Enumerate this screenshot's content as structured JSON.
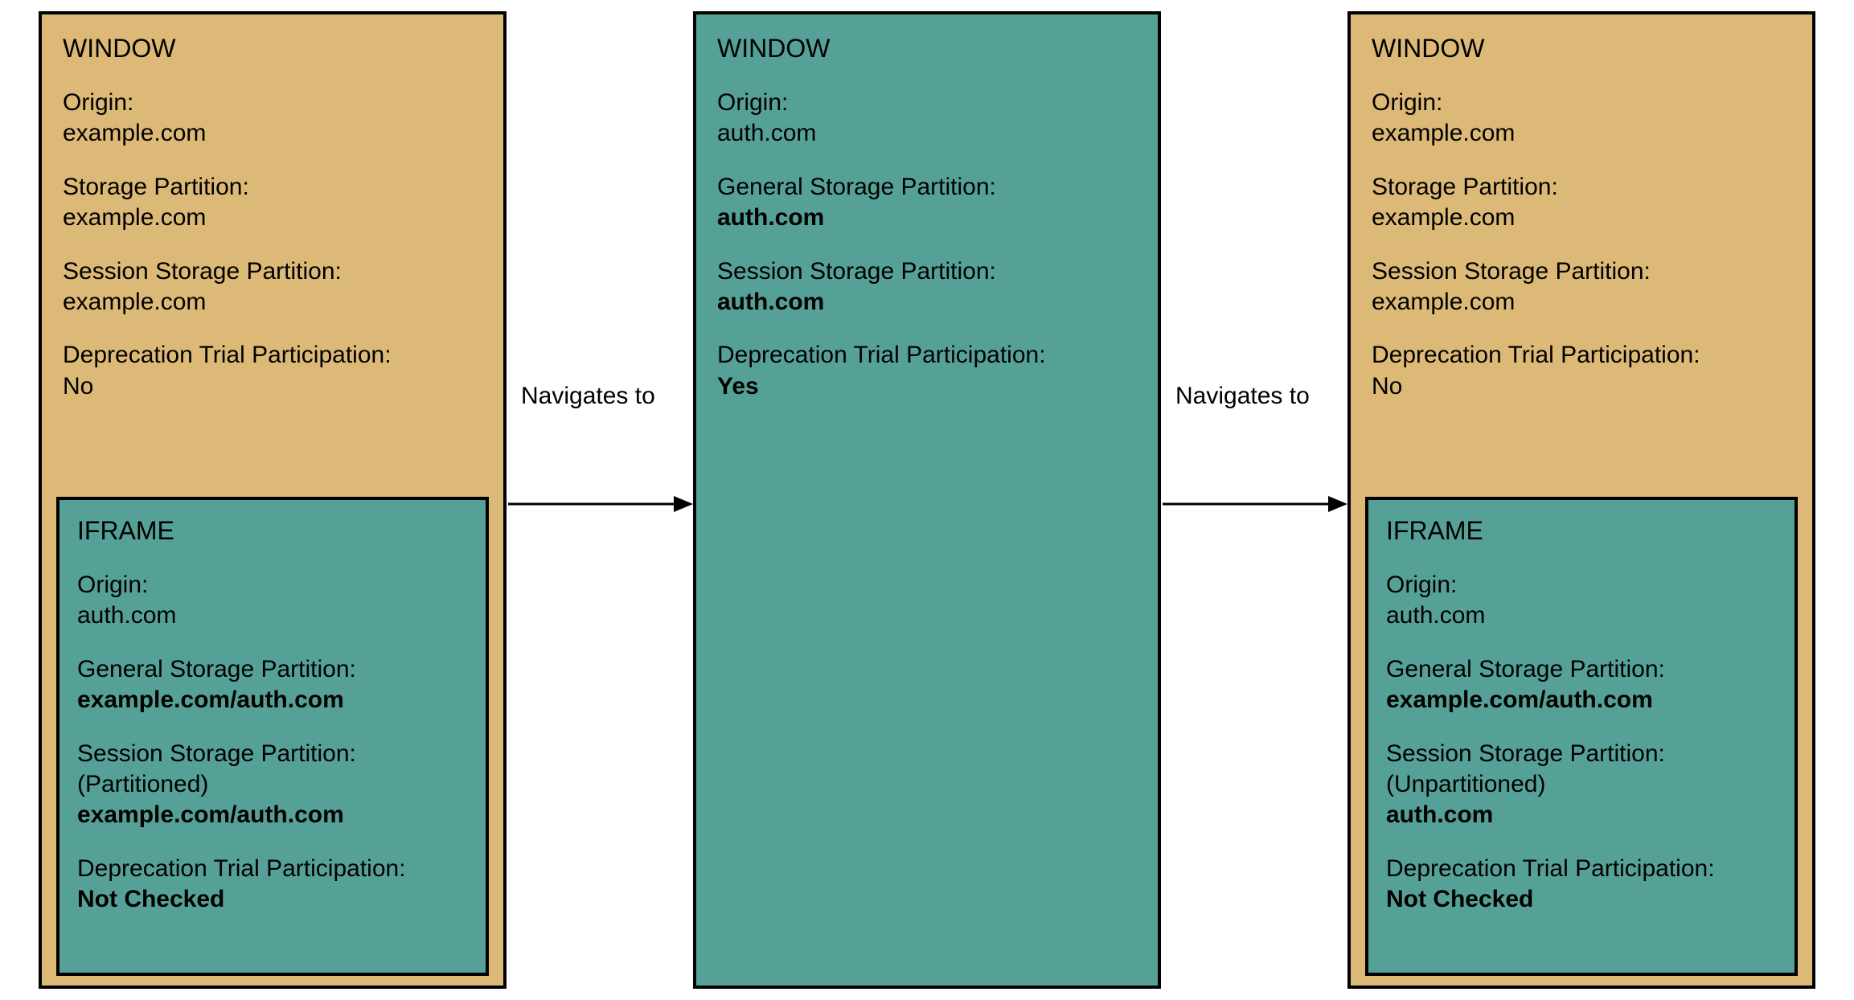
{
  "colors": {
    "tan": "#dcb976",
    "teal": "#56a197",
    "border": "#000000"
  },
  "nav": {
    "label1": "Navigates to",
    "label2": "Navigates to"
  },
  "panel1": {
    "title": "WINDOW",
    "origin_label": "Origin:",
    "origin_value": "example.com",
    "storage_label": "Storage Partition:",
    "storage_value": "example.com",
    "session_label": "Session Storage Partition:",
    "session_value": "example.com",
    "dep_label": "Deprecation Trial Participation:",
    "dep_value": "No",
    "iframe": {
      "title": "IFRAME",
      "origin_label": "Origin:",
      "origin_value": "auth.com",
      "general_label": "General Storage Partition:",
      "general_value": "example.com/auth.com",
      "session_label": "Session Storage Partition:",
      "session_note": "(Partitioned)",
      "session_value": "example.com/auth.com",
      "dep_label": "Deprecation Trial Participation:",
      "dep_value": "Not Checked"
    }
  },
  "panel2": {
    "title": "WINDOW",
    "origin_label": "Origin:",
    "origin_value": "auth.com",
    "general_label": "General Storage Partition:",
    "general_value": "auth.com",
    "session_label": "Session Storage Partition:",
    "session_value": "auth.com",
    "dep_label": "Deprecation Trial Participation:",
    "dep_value": "Yes"
  },
  "panel3": {
    "title": "WINDOW",
    "origin_label": "Origin:",
    "origin_value": "example.com",
    "storage_label": "Storage Partition:",
    "storage_value": "example.com",
    "session_label": "Session Storage Partition:",
    "session_value": "example.com",
    "dep_label": "Deprecation Trial Participation:",
    "dep_value": "No",
    "iframe": {
      "title": "IFRAME",
      "origin_label": "Origin:",
      "origin_value": "auth.com",
      "general_label": "General Storage Partition:",
      "general_value": "example.com/auth.com",
      "session_label": "Session Storage Partition:",
      "session_note": "(Unpartitioned)",
      "session_value": "auth.com",
      "dep_label": "Deprecation Trial Participation:",
      "dep_value": "Not Checked"
    }
  }
}
